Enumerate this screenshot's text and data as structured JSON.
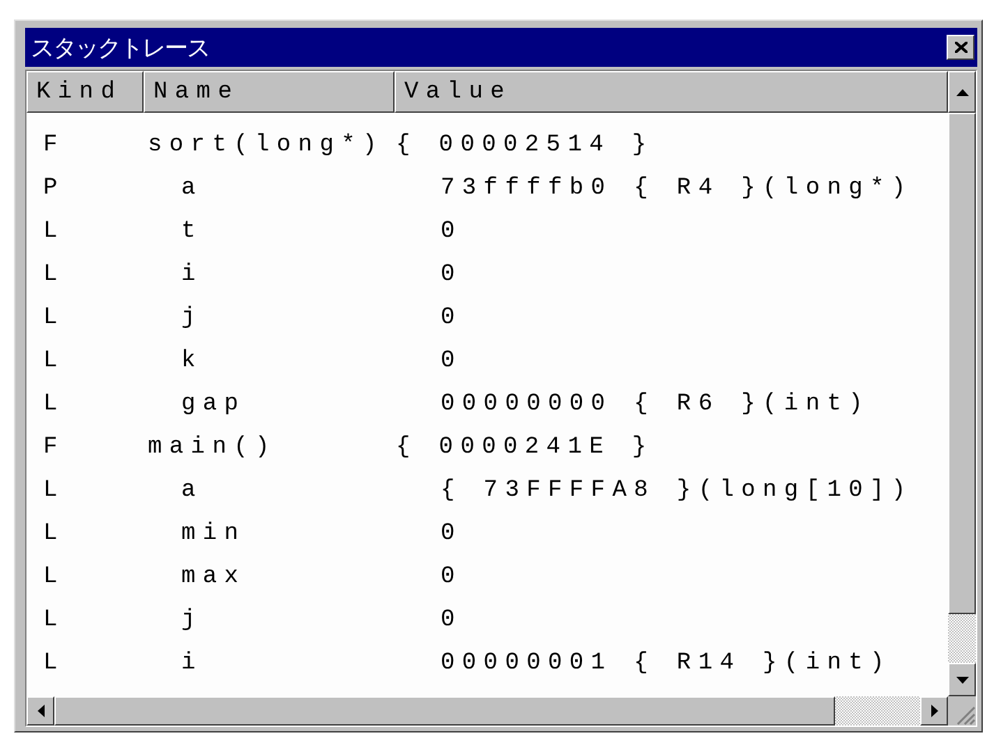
{
  "window": {
    "title": "スタックトレース"
  },
  "columns": [
    "Kind",
    "Name",
    "Value"
  ],
  "rows": [
    {
      "kind": "F",
      "name": "sort(long*)",
      "value": "{ 00002514 }",
      "children": [
        {
          "kind": "P",
          "name": "a",
          "value": "73ffffb0 { R4 }(long*)"
        },
        {
          "kind": "L",
          "name": "t",
          "value": "0"
        },
        {
          "kind": "L",
          "name": "i",
          "value": "0"
        },
        {
          "kind": "L",
          "name": "j",
          "value": "0"
        },
        {
          "kind": "L",
          "name": "k",
          "value": "0"
        },
        {
          "kind": "L",
          "name": "gap",
          "value": "00000000 { R6 }(int)"
        }
      ]
    },
    {
      "kind": "F",
      "name": "main()",
      "value": "{ 0000241E }",
      "children": [
        {
          "kind": "L",
          "name": "a",
          "value": "{ 73FFFFA8 }(long[10])"
        },
        {
          "kind": "L",
          "name": "min",
          "value": "0"
        },
        {
          "kind": "L",
          "name": "max",
          "value": "0"
        },
        {
          "kind": "L",
          "name": "j",
          "value": "0"
        },
        {
          "kind": "L",
          "name": "i",
          "value": "00000001 { R14 }(int)"
        }
      ]
    }
  ]
}
